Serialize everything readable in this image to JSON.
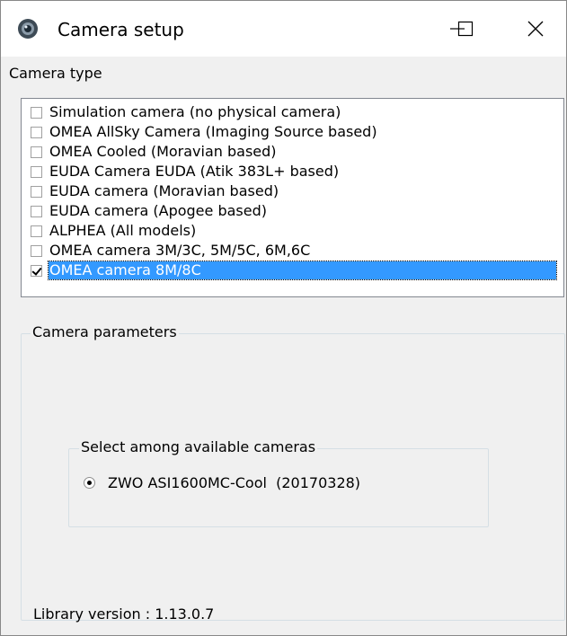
{
  "window": {
    "title": "Camera setup",
    "minimize_glyph": "—",
    "maximize_glyph": "☐",
    "close_glyph": "✕"
  },
  "camera_type": {
    "label": "Camera type",
    "items": [
      {
        "label": "Simulation camera (no physical camera)",
        "checked": false
      },
      {
        "label": "OMEA AllSky Camera (Imaging Source based)",
        "checked": false
      },
      {
        "label": "OMEA Cooled (Moravian based)",
        "checked": false
      },
      {
        "label": "EUDA Camera EUDA (Atik 383L+ based)",
        "checked": false
      },
      {
        "label": "EUDA camera (Moravian based)",
        "checked": false
      },
      {
        "label": "EUDA camera (Apogee based)",
        "checked": false
      },
      {
        "label": "ALPHEA (All models)",
        "checked": false
      },
      {
        "label": "OMEA camera 3M/3C, 5M/5C, 6M,6C",
        "checked": false
      },
      {
        "label": "OMEA camera 8M/8C",
        "checked": true,
        "selected": true
      }
    ]
  },
  "camera_parameters": {
    "label": "Camera parameters",
    "select_group_label": "Select among available cameras",
    "cameras": [
      {
        "label": "ZWO ASI1600MC-Cool  (20170328)",
        "selected": true
      }
    ],
    "library_version": "Library version : 1.13.0.7"
  },
  "colors": {
    "selection": "#3399ff",
    "background": "#f0f0f0"
  }
}
